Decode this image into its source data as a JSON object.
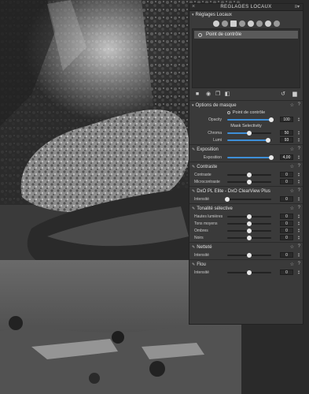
{
  "panel": {
    "title": "RÉGLAGES LOCAUX",
    "close_icon": "close-icon",
    "menu_icon": "panel-menu-icon"
  },
  "local_adjustments": {
    "label": "Réglages Locaux",
    "tools": [
      "control-point-tool",
      "gradient-tool",
      "brush-tool",
      "eraser-tool",
      "auto-mask-tool",
      "eyedropper-tool",
      "pin-tool",
      "eye-tool"
    ],
    "mask_item": "Point de contrôle"
  },
  "mask_options": {
    "label": "Options de masque",
    "point_label": "Point de contrôle",
    "opacity": {
      "label": "Opacity",
      "value": "100",
      "level": 1.0
    },
    "selectivity_label": "Mask Selectivity",
    "chroma": {
      "label": "Chroma",
      "value": "50",
      "level": 0.5
    },
    "lumi": {
      "label": "Lumi",
      "value": "93",
      "level": 0.93
    }
  },
  "exposition": {
    "label": "Exposition",
    "slider": {
      "label": "Exposition",
      "value": "4,00",
      "level": 1.0
    }
  },
  "contraste": {
    "label": "Contraste",
    "rows": [
      {
        "label": "Contraste",
        "value": "0",
        "level": 0.5
      },
      {
        "label": "Microcontraste",
        "value": "0",
        "level": 0.5
      }
    ]
  },
  "clearview": {
    "label": "DxO PL Elite - DxO ClearView Plus",
    "slider": {
      "label": "Intensité",
      "value": "0",
      "level": 0.0
    }
  },
  "tonalite": {
    "label": "Tonalité sélective",
    "rows": [
      {
        "label": "Hautes lumières",
        "value": "0",
        "level": 0.5
      },
      {
        "label": "Tons moyens",
        "value": "0",
        "level": 0.5
      },
      {
        "label": "Ombres",
        "value": "0",
        "level": 0.5
      },
      {
        "label": "Noirs",
        "value": "0",
        "level": 0.5
      }
    ]
  },
  "nettete": {
    "label": "Netteté",
    "slider": {
      "label": "Intensité",
      "value": "0",
      "level": 0.5
    }
  },
  "flou": {
    "label": "Flou",
    "slider": {
      "label": "Intensité",
      "value": "0",
      "level": 0.5
    }
  }
}
